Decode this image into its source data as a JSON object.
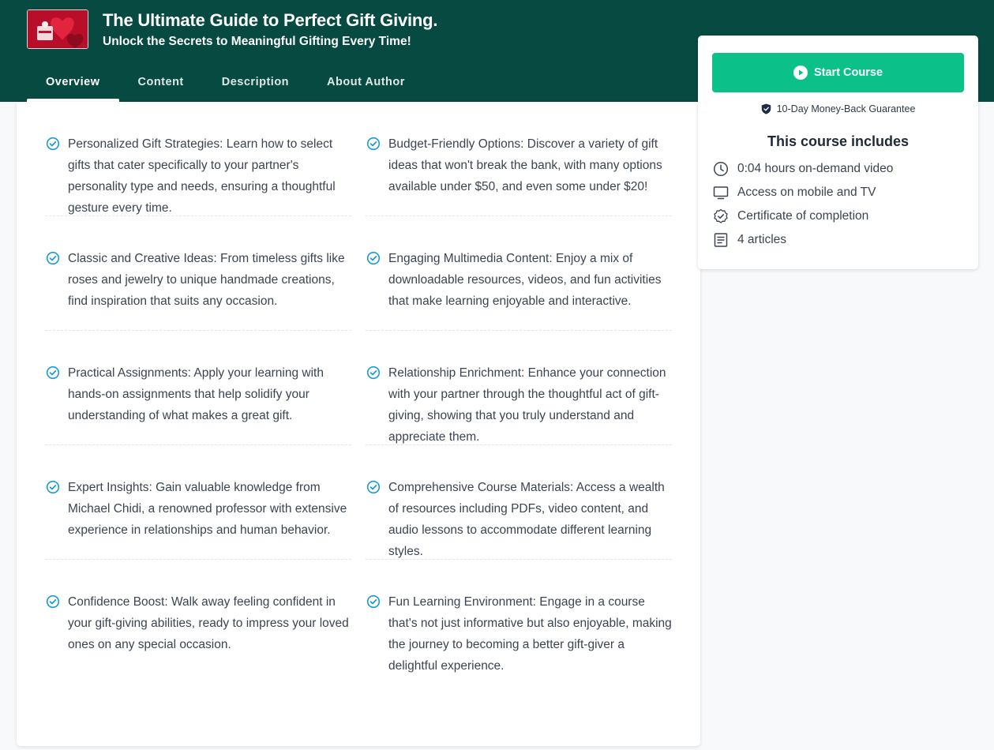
{
  "course": {
    "title": "The Ultimate Guide to Perfect Gift Giving.",
    "subtitle": "Unlock the Secrets to Meaningful Gifting Every Time!"
  },
  "tabs": [
    {
      "label": "Overview",
      "active": true
    },
    {
      "label": "Content",
      "active": false
    },
    {
      "label": "Description",
      "active": false
    },
    {
      "label": "About Author",
      "active": false
    }
  ],
  "features": [
    "Personalized Gift Strategies: Learn how to select gifts that cater specifically to your partner's personality type and needs, ensuring a thoughtful gesture every time.",
    "Budget-Friendly Options: Discover a variety of gift ideas that won't break the bank, with many options available under $50, and even some under $20!",
    "Classic and Creative Ideas: From timeless gifts like roses and jewelry to unique handmade creations, find inspiration that suits any occasion.",
    "Engaging Multimedia Content: Enjoy a mix of downloadable resources, videos, and fun activities that make learning enjoyable and interactive.",
    "Practical Assignments: Apply your learning with hands-on assignments that help solidify your understanding of what makes a great gift.",
    "Relationship Enrichment: Enhance your connection with your partner through the thoughtful act of gift-giving, showing that you truly understand and appreciate them.",
    "Expert Insights: Gain valuable knowledge from Michael Chidi, a renowned professor with extensive experience in relationships and human behavior.",
    "Comprehensive Course Materials: Access a wealth of resources including PDFs, video content, and audio lessons to accommodate different learning styles.",
    "Confidence Boost: Walk away feeling confident in your gift-giving abilities, ready to impress your loved ones on any special occasion.",
    "Fun Learning Environment: Engage in a course that's not just informative but also enjoyable, making the journey to becoming a better gift-giver a delightful experience."
  ],
  "sidebar": {
    "start_label": "Start Course",
    "guarantee": "10-Day Money-Back Guarantee",
    "includes_title": "This course includes",
    "includes": [
      {
        "icon": "clock-icon",
        "label": "0:04 hours on-demand video"
      },
      {
        "icon": "monitor-icon",
        "label": "Access on mobile and TV"
      },
      {
        "icon": "certificate-badge-icon",
        "label": "Certificate of completion"
      },
      {
        "icon": "article-icon",
        "label": "4 articles"
      }
    ]
  },
  "colors": {
    "header_bg": "#064a42",
    "accent_green": "#0cc08a",
    "check_blue": "#1a9ad6"
  }
}
